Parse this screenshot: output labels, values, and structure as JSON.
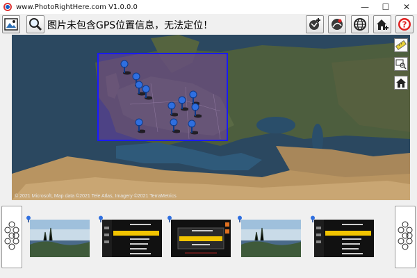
{
  "window": {
    "title": "www.PhotoRightHere.com V1.0.0.0",
    "minimize": "—",
    "maximize": "☐",
    "close": "✕"
  },
  "toolbar": {
    "status_message": "图片未包含GPS位置信息，无法定位！",
    "left_buttons": [
      "open-photo-icon",
      "search-icon"
    ],
    "right_buttons": [
      "add-location-icon",
      "route-icon",
      "globe-grid-icon",
      "home-plus-icon",
      "help-icon"
    ]
  },
  "map": {
    "attribution": "© 2021 Microsoft, Map data ©2021 Tele Atlas, Imagery ©2021 TerraMetrics",
    "pin_count": 11,
    "side_buttons": [
      "ruler-icon",
      "zoom-window-icon",
      "home-icon"
    ]
  },
  "filmstrip": {
    "prev_icon": "hexagon-cluster-icon",
    "next_icon": "hexagon-cluster-icon",
    "thumbnails": [
      {
        "kind": "landscape"
      },
      {
        "kind": "camera-menu"
      },
      {
        "kind": "camera-menu"
      },
      {
        "kind": "landscape"
      },
      {
        "kind": "camera-menu"
      }
    ]
  },
  "colors": {
    "selection_border": "#1a1aff",
    "selection_fill": "#783cb4",
    "pin_blue": "#2f6fe0",
    "help_red": "#e02020"
  }
}
